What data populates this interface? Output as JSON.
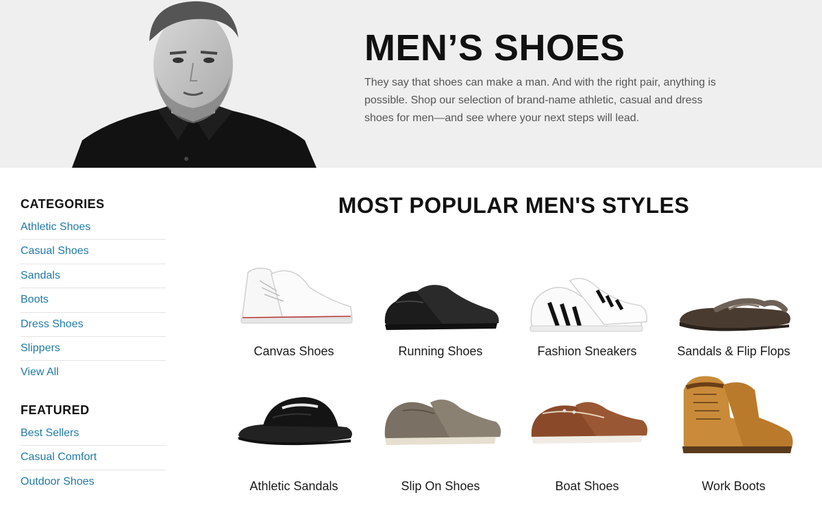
{
  "hero": {
    "title": "MEN’S SHOES",
    "description": "They say that shoes can make a man. And with the right pair, anything is possible. Shop our selection of brand-name athletic, casual and dress shoes for men—and see where your next steps will lead."
  },
  "sidebar": {
    "categories_heading": "CATEGORIES",
    "categories": [
      {
        "label": "Athletic Shoes"
      },
      {
        "label": "Casual Shoes"
      },
      {
        "label": "Sandals"
      },
      {
        "label": "Boots"
      },
      {
        "label": "Dress Shoes"
      },
      {
        "label": "Slippers"
      },
      {
        "label": "View All"
      }
    ],
    "featured_heading": "FEATURED",
    "featured": [
      {
        "label": "Best Sellers"
      },
      {
        "label": "Casual Comfort"
      },
      {
        "label": "Outdoor Shoes"
      }
    ]
  },
  "main": {
    "title": "MOST POPULAR MEN'S STYLES",
    "styles": [
      {
        "label": "Canvas Shoes",
        "icon": "canvas-shoe-image"
      },
      {
        "label": "Running Shoes",
        "icon": "running-shoe-image"
      },
      {
        "label": "Fashion Sneakers",
        "icon": "fashion-sneaker-image"
      },
      {
        "label": "Sandals & Flip Flops",
        "icon": "flip-flop-image"
      },
      {
        "label": "Athletic Sandals",
        "icon": "athletic-sandal-image"
      },
      {
        "label": "Slip On Shoes",
        "icon": "slip-on-shoe-image"
      },
      {
        "label": "Boat Shoes",
        "icon": "boat-shoe-image"
      },
      {
        "label": "Work Boots",
        "icon": "work-boot-image"
      }
    ]
  },
  "colors": {
    "link": "#1f7aa8",
    "hero_background": "#efefef",
    "divider": "#e3e3e3"
  }
}
